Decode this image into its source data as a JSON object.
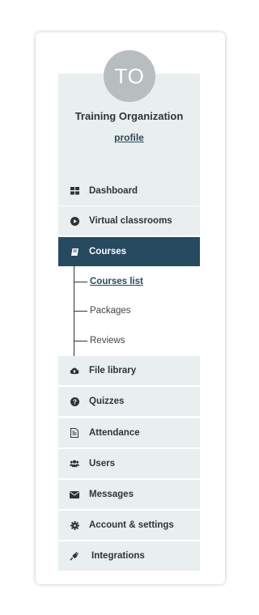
{
  "profile": {
    "initials": "TO",
    "org_name": "Training Organization",
    "link_label": "profile"
  },
  "menu": {
    "dashboard": "Dashboard",
    "virtual_classrooms": "Virtual classrooms",
    "courses": "Courses",
    "file_library": "File library",
    "quizzes": "Quizzes",
    "attendance": "Attendance",
    "users": "Users",
    "messages": "Messages",
    "account_settings": "Account & settings",
    "integrations": "Integrations"
  },
  "submenu": {
    "courses_list": "Courses list",
    "packages": "Packages",
    "reviews": "Reviews"
  },
  "colors": {
    "active_bg": "#264a5f",
    "item_bg": "#e9eeef",
    "avatar_bg": "#b8bdbf"
  },
  "active_item": "courses",
  "current_subitem": "courses_list"
}
